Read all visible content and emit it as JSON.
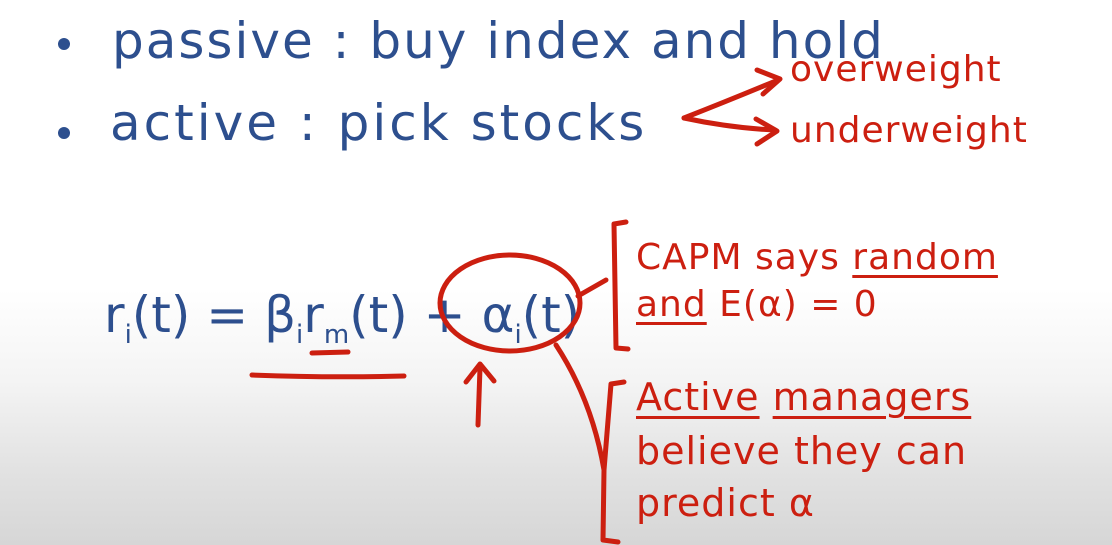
{
  "bullets": {
    "passive": "passive : buy index and hold",
    "active": "active : pick stocks"
  },
  "branches": {
    "overweight": "overweight",
    "underweight": "underweight"
  },
  "equation": {
    "r": "r",
    "i1": "i",
    "t1": "(t) = ",
    "beta": "β",
    "i2": "i",
    "rm": "r",
    "m": "m",
    "t2": "(t) + ",
    "alpha": "α",
    "i3": "i",
    "t3": "(t)"
  },
  "capm": {
    "says": "CAPM says ",
    "random": "random",
    "and": "and",
    "expect": " E(α) = 0"
  },
  "active_managers": {
    "active": "Active",
    "managers": "managers",
    "line2": "believe they can",
    "line3": "predict α"
  },
  "colors": {
    "blue_ink": "#2d4f8e",
    "red_ink": "#cc1f10"
  }
}
